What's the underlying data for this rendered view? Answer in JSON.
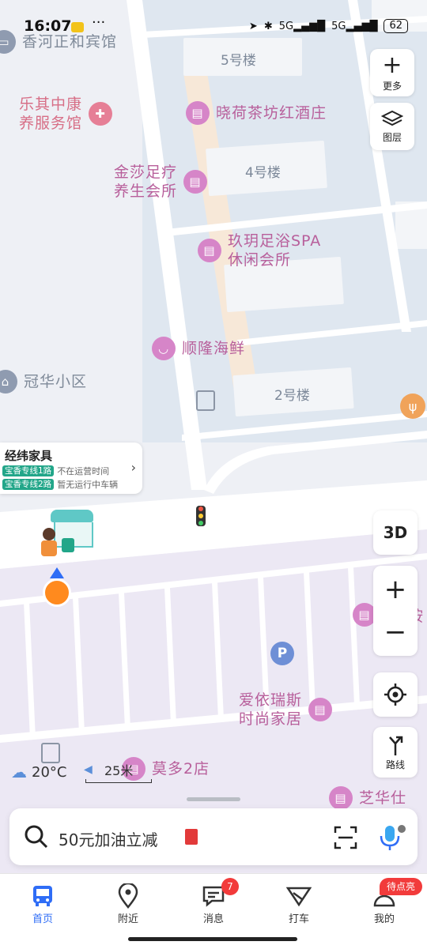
{
  "status_bar": {
    "time": "16:07",
    "battery": "62",
    "network_1": "5G",
    "network_2": "5G"
  },
  "map": {
    "pois": [
      {
        "name": "香河正和宾馆",
        "style": "gray"
      },
      {
        "name": "乐其中康",
        "name2": "养服务馆",
        "style": "red"
      },
      {
        "name": "晓荷茶坊红酒庄",
        "style": "purple"
      },
      {
        "name": "金莎足疗",
        "name2": "养生会所",
        "style": "purple"
      },
      {
        "name": "玖玥足浴SPA",
        "name2": "休闲会所",
        "style": "purple"
      },
      {
        "name": "顺隆海鲜",
        "style": "purple"
      },
      {
        "name": "冠华小区",
        "style": "gray"
      },
      {
        "name": "爱依瑞斯",
        "name2": "时尚家居",
        "style": "purple"
      },
      {
        "name": "莫多2店",
        "style": "purple"
      },
      {
        "name": "芝华仕",
        "style": "purple"
      }
    ],
    "buildings": [
      "5号楼",
      "4号楼",
      "2号楼"
    ],
    "parking": "P"
  },
  "controls": {
    "more_label": "更多",
    "layers_label": "图层",
    "view_3d_label": "3D",
    "route_label": "路线"
  },
  "bus_card": {
    "title": "经纬家具",
    "lines": [
      {
        "tag": "宝香专线1路",
        "status": "不在运营时间"
      },
      {
        "tag": "宝香专线2路",
        "status": "暂无运行中车辆"
      }
    ]
  },
  "weather": {
    "temp": "20°C"
  },
  "scale": {
    "label": "25米"
  },
  "search": {
    "placeholder": "50元加油立减"
  },
  "tabs": [
    {
      "label": "首页",
      "active": true
    },
    {
      "label": "附近"
    },
    {
      "label": "消息",
      "badge": "7"
    },
    {
      "label": "打车"
    },
    {
      "label": "我的",
      "badge": "待点亮"
    }
  ],
  "colors": {
    "accent": "#2f6df6",
    "poi_purple": "#d685c8",
    "bus_tag": "#22a689"
  }
}
